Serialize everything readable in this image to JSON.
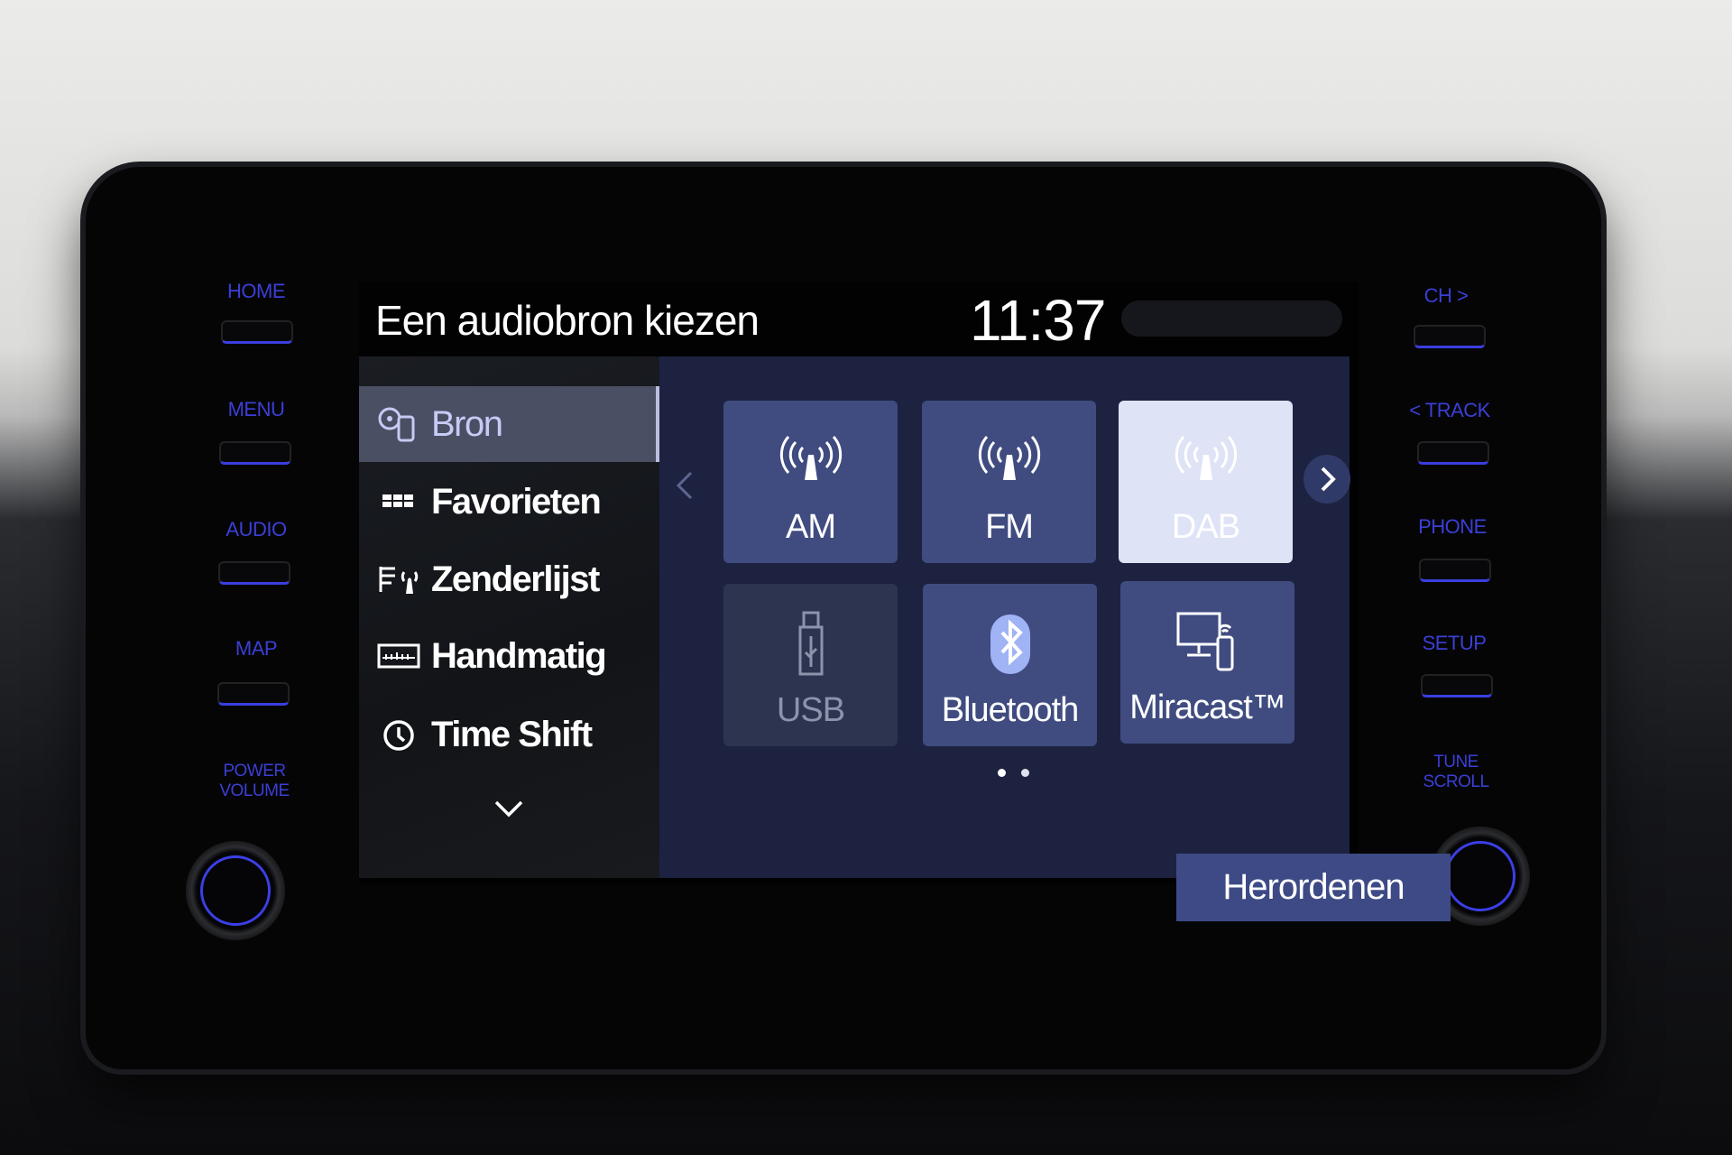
{
  "hardware": {
    "left": [
      {
        "label": "HOME"
      },
      {
        "label": "MENU"
      },
      {
        "label": "AUDIO"
      },
      {
        "label": "MAP"
      }
    ],
    "left_knob_label": [
      "POWER",
      "VOLUME"
    ],
    "right": [
      {
        "label": "CH >"
      },
      {
        "label": "< TRACK"
      },
      {
        "label": "PHONE"
      },
      {
        "label": "SETUP"
      }
    ],
    "right_knob_label": [
      "TUNE",
      "SCROLL"
    ],
    "accent_color": "#3b3fd6"
  },
  "header": {
    "title": "Een audiobron kiezen",
    "clock": "11:37"
  },
  "sidebar": {
    "items": [
      {
        "label": "Bron",
        "icon": "source-icon",
        "selected": true
      },
      {
        "label": "Favorieten",
        "icon": "favorites-grid-icon"
      },
      {
        "label": "Zenderlijst",
        "icon": "station-list-icon"
      },
      {
        "label": "Handmatig",
        "icon": "manual-tuning-icon"
      },
      {
        "label": "Time Shift",
        "icon": "clock-icon"
      }
    ]
  },
  "sources": [
    {
      "label": "AM",
      "icon": "antenna-icon"
    },
    {
      "label": "FM",
      "icon": "antenna-icon"
    },
    {
      "label": "DAB",
      "icon": "antenna-icon",
      "selected": true
    },
    {
      "label": "USB",
      "icon": "usb-icon",
      "disabled": true
    },
    {
      "label": "Bluetooth",
      "icon": "bluetooth-icon"
    },
    {
      "label": "Miracast™",
      "icon": "miracast-icon"
    }
  ],
  "pagination": {
    "current": 1,
    "total": 2
  },
  "reorder_label": "Herordenen"
}
